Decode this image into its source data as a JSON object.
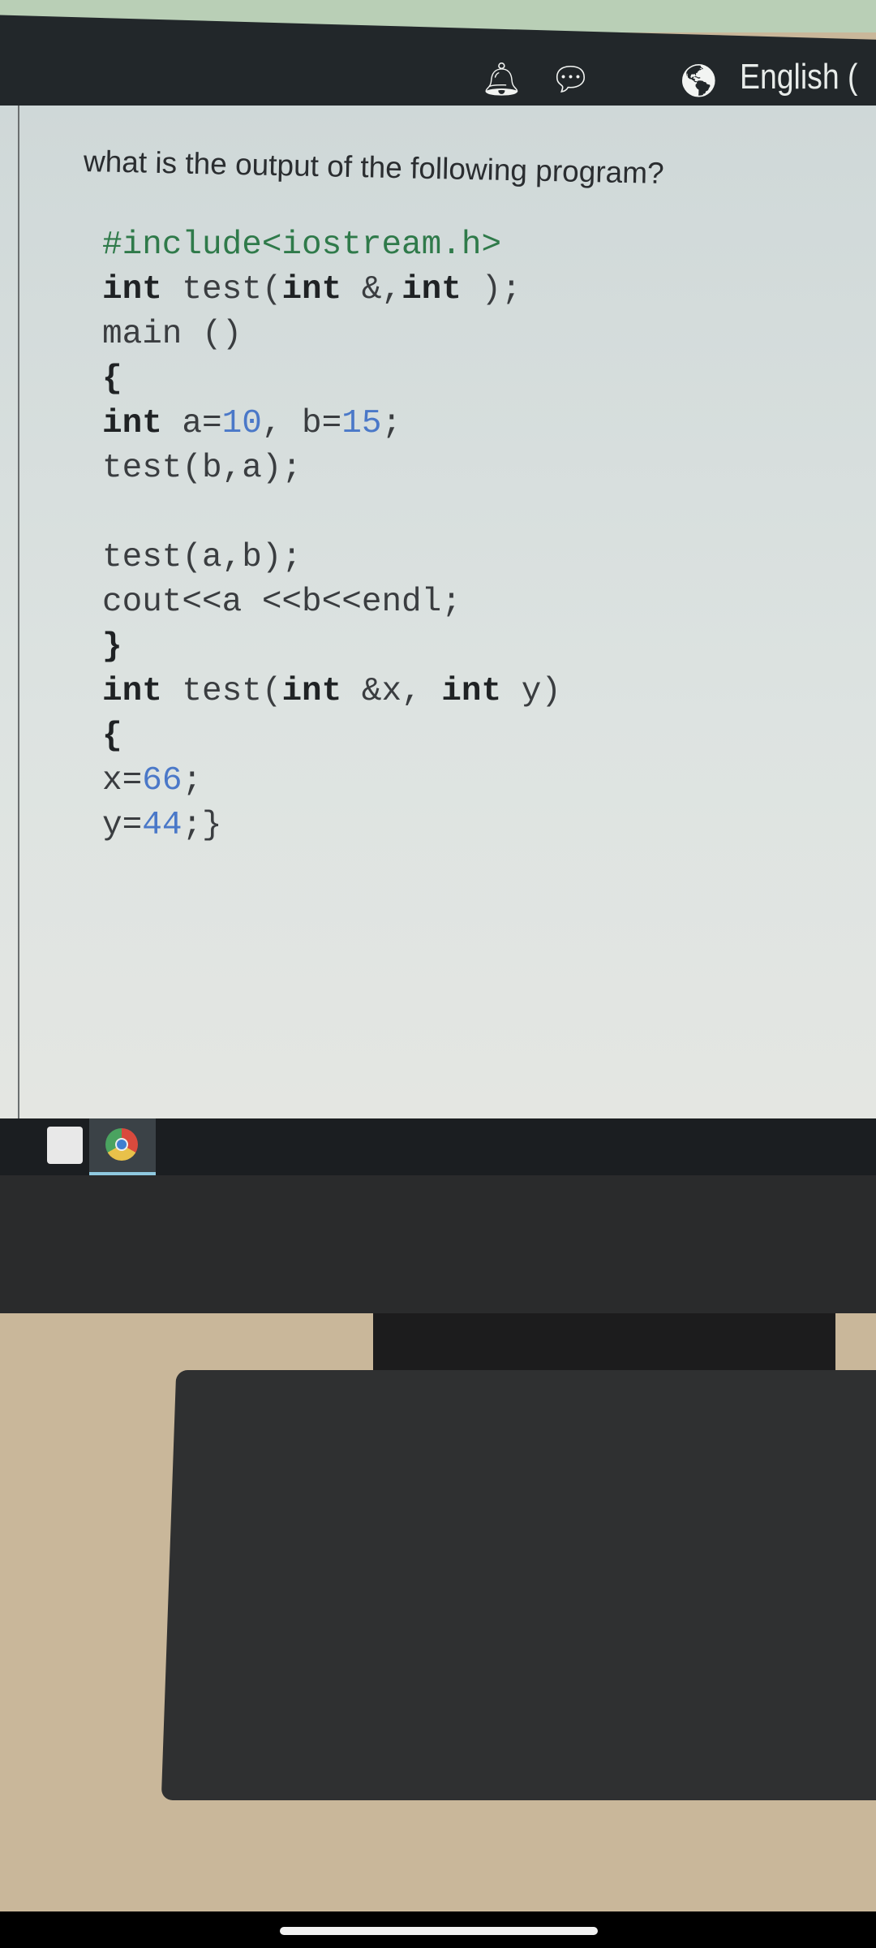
{
  "header": {
    "icons": [
      "bell-icon",
      "chat-icon",
      "globe-icon"
    ],
    "language_label": "English ("
  },
  "question": {
    "text": "what is the output of the following program?",
    "code_lines": [
      [
        {
          "t": "#include<iostream.h>",
          "c": "pp"
        }
      ],
      [
        {
          "t": "int",
          "c": "kw"
        },
        {
          "t": " test(",
          "c": ""
        },
        {
          "t": "int",
          "c": "kw"
        },
        {
          "t": " &,",
          "c": ""
        },
        {
          "t": "int",
          "c": "kw"
        },
        {
          "t": " );",
          "c": ""
        }
      ],
      [
        {
          "t": "main ()",
          "c": ""
        }
      ],
      [
        {
          "t": "{",
          "c": "kw"
        }
      ],
      [
        {
          "t": "int",
          "c": "kw"
        },
        {
          "t": " a=",
          "c": ""
        },
        {
          "t": "10",
          "c": "num"
        },
        {
          "t": ", b=",
          "c": ""
        },
        {
          "t": "15",
          "c": "num"
        },
        {
          "t": ";",
          "c": ""
        }
      ],
      [
        {
          "t": "test(b,a);",
          "c": ""
        }
      ],
      [
        {
          "t": "",
          "c": ""
        }
      ],
      [
        {
          "t": "test(a,b);",
          "c": ""
        }
      ],
      [
        {
          "t": "cout<<a <<b<<endl;",
          "c": ""
        }
      ],
      [
        {
          "t": "}",
          "c": "kw"
        }
      ],
      [
        {
          "t": "int",
          "c": "kw"
        },
        {
          "t": " test(",
          "c": ""
        },
        {
          "t": "int",
          "c": "kw"
        },
        {
          "t": " &x, ",
          "c": ""
        },
        {
          "t": "int",
          "c": "kw"
        },
        {
          "t": " y)",
          "c": ""
        }
      ],
      [
        {
          "t": "{",
          "c": "kw"
        }
      ],
      [
        {
          "t": "x=",
          "c": ""
        },
        {
          "t": "66",
          "c": "num"
        },
        {
          "t": ";",
          "c": ""
        }
      ],
      [
        {
          "t": "y=",
          "c": ""
        },
        {
          "t": "44",
          "c": "num"
        },
        {
          "t": ";}",
          "c": ""
        }
      ]
    ]
  },
  "taskbar": {
    "icons": [
      "store-icon",
      "chrome-icon"
    ]
  },
  "colors": {
    "header": "#22272a",
    "number_literal": "#4a78c8",
    "preprocessor": "#2f7a4a"
  }
}
